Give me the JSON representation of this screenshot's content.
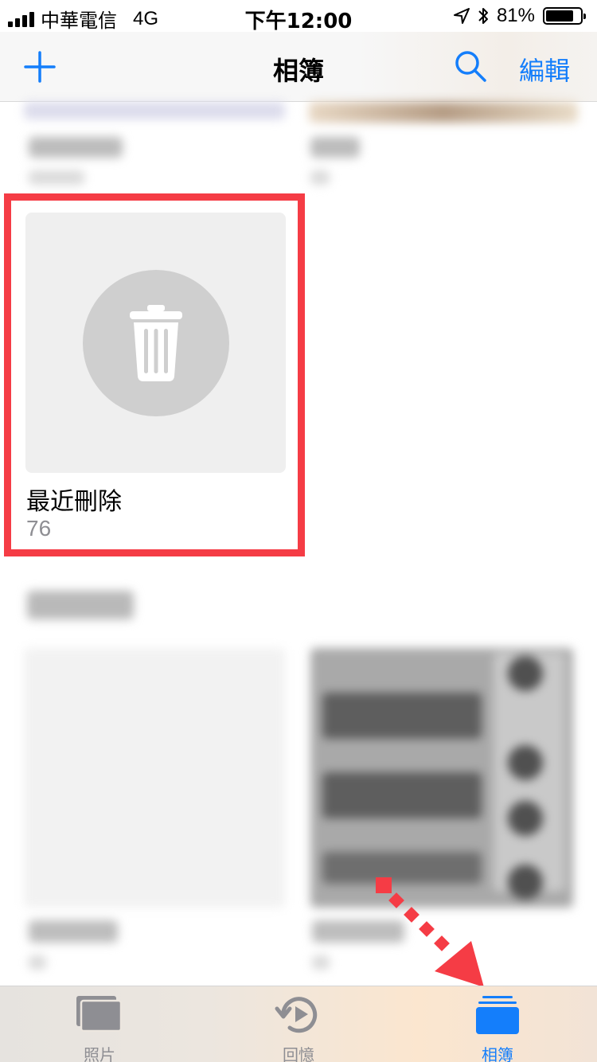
{
  "status_bar": {
    "carrier": "中華電信",
    "network": "4G",
    "time": "下午12:00",
    "battery_text": "81%",
    "battery_level": 0.81
  },
  "nav": {
    "title": "相簿",
    "edit_label": "編輯"
  },
  "highlighted_album": {
    "title": "最近刪除",
    "count": "76"
  },
  "tabs": [
    {
      "label": "照片",
      "icon": "photos-icon",
      "active": false
    },
    {
      "label": "回憶",
      "icon": "memories-icon",
      "active": false
    },
    {
      "label": "相簿",
      "icon": "albums-icon",
      "active": true
    }
  ],
  "colors": {
    "accent": "#147efb",
    "highlight": "#f53c45",
    "inactive": "#8e8e93"
  }
}
